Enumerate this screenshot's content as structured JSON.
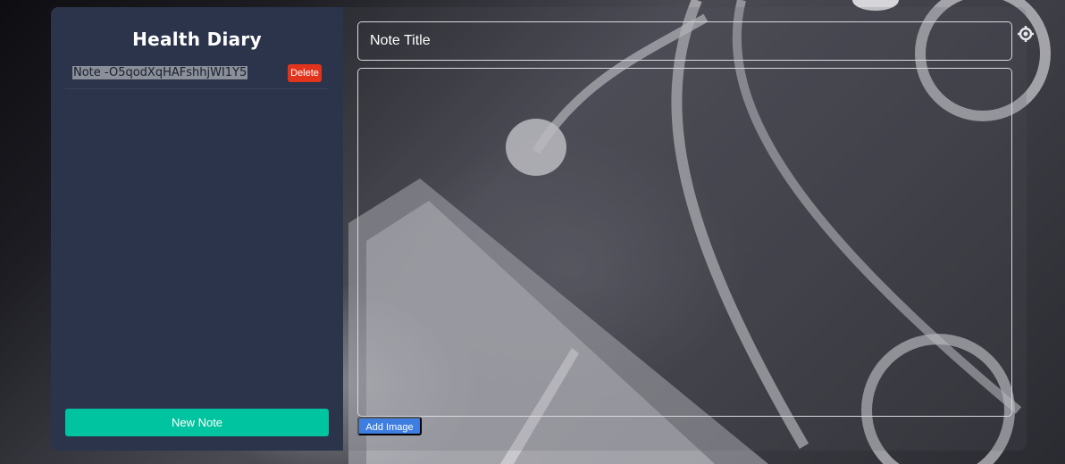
{
  "sidebar": {
    "app_title": "Health Diary",
    "notes": [
      {
        "title": "Note -O5qodXqHAFshhjWI1Y5",
        "delete_label": "Delete"
      }
    ],
    "new_note_label": "New Note"
  },
  "editor": {
    "title_placeholder": "Note Title",
    "body_value": "",
    "add_image_label": "Add Image"
  },
  "colors": {
    "sidebar_bg": "#2c344c",
    "delete": "#e2341d",
    "new_note": "#00c4a0",
    "add_image": "#3d7ee0"
  },
  "icons": [
    "settings-icon"
  ]
}
